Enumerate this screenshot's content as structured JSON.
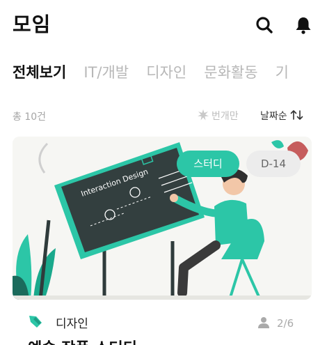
{
  "header": {
    "title": "모임",
    "search_icon": "search-icon",
    "bell_icon": "bell-icon"
  },
  "tabs": [
    {
      "label": "전체보기",
      "active": true
    },
    {
      "label": "IT/개발",
      "active": false
    },
    {
      "label": "디자인",
      "active": false
    },
    {
      "label": "문화활동",
      "active": false
    },
    {
      "label": "기",
      "active": false
    }
  ],
  "meta": {
    "total": "총 10건",
    "only_label": "번개만",
    "sort_label": "날짜순"
  },
  "card": {
    "image_text": "Interaction Design",
    "badges": {
      "type": "스터디",
      "dday": "D-14"
    },
    "category": "디자인",
    "members": "2/6",
    "title": "예술 작품 스터디"
  },
  "colors": {
    "accent": "#2cc6a7",
    "badge_gray": "#ececec",
    "muted": "#b7b7b7",
    "dark": "#111111"
  }
}
